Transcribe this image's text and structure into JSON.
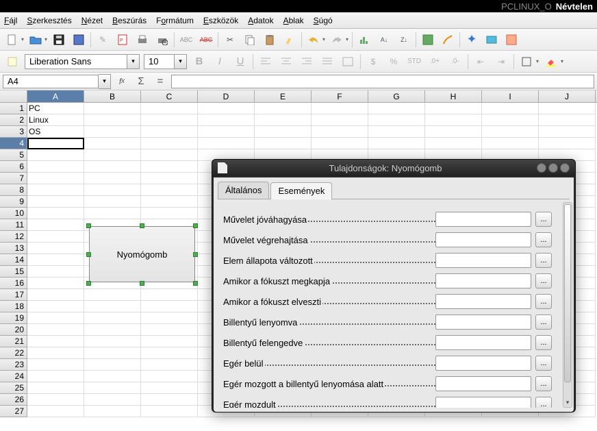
{
  "titlebar": {
    "mid": "PCLINUX_O",
    "right": "Névtelen"
  },
  "menu": [
    {
      "label": "Fájl",
      "ul": 0
    },
    {
      "label": "Szerkesztés",
      "ul": 0
    },
    {
      "label": "Nézet",
      "ul": 0
    },
    {
      "label": "Beszúrás",
      "ul": 0
    },
    {
      "label": "Formátum",
      "ul": 1
    },
    {
      "label": "Eszközök",
      "ul": 0
    },
    {
      "label": "Adatok",
      "ul": 0
    },
    {
      "label": "Ablak",
      "ul": 0
    },
    {
      "label": "Súgó",
      "ul": 0
    }
  ],
  "font": {
    "name": "Liberation Sans",
    "size": "10"
  },
  "cellref": "A4",
  "columns": [
    "A",
    "B",
    "C",
    "D",
    "E",
    "F",
    "G",
    "H",
    "I",
    "J"
  ],
  "cells": {
    "A1": "PC",
    "A2": "Linux",
    "A3": "OS"
  },
  "button_label": "Nyomógomb",
  "dialog": {
    "title": "Tulajdonságok: Nyomógomb",
    "tabs": [
      "Általános",
      "Események"
    ],
    "active_tab": 1,
    "events": [
      "Művelet jóváhagyása",
      "Művelet végrehajtása",
      "Elem állapota változott",
      "Amikor a fókuszt megkapja",
      "Amikor a fókuszt elveszti",
      "Billentyű lenyomva",
      "Billentyű felengedve",
      "Egér belül",
      "Egér mozgott a billentyű lenyomása alatt",
      "Egér mozdult"
    ],
    "btn_label": "..."
  }
}
